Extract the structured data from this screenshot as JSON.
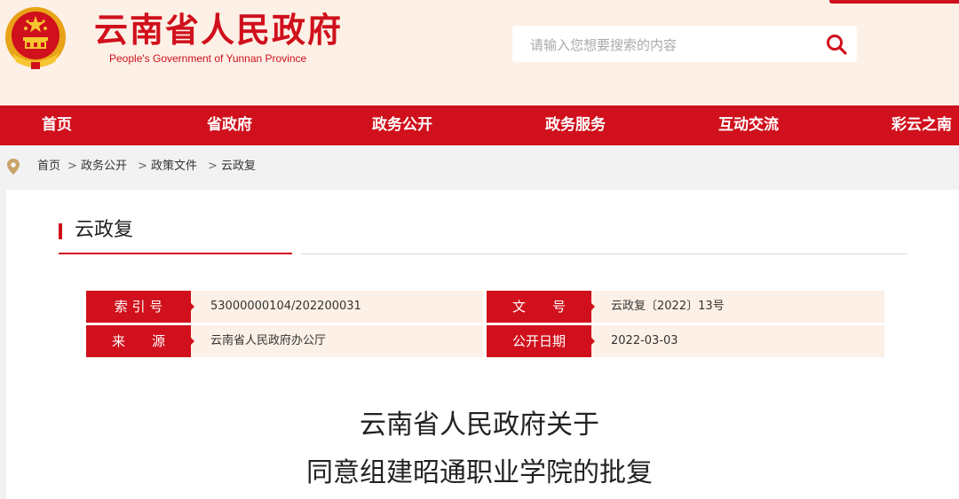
{
  "header": {
    "title": "云南省人民政府",
    "subtitle": "People's Government of Yunnan Province",
    "search_placeholder": "请输入您想要搜索的内容"
  },
  "nav": {
    "items": [
      "首页",
      "省政府",
      "政务公开",
      "政务服务",
      "互动交流",
      "彩云之南"
    ]
  },
  "breadcrumb": {
    "items": [
      "首页",
      "政务公开",
      "政策文件",
      "云政复"
    ],
    "separator": ">"
  },
  "section": {
    "title": "云政复"
  },
  "meta": {
    "index_label": "索 引 号",
    "index_value": "53000000104/202200031",
    "docno_label": "文　　号",
    "docno_value": "云政复〔2022〕13号",
    "source_label": "来　　源",
    "source_value": "云南省人民政府办公厅",
    "date_label": "公开日期",
    "date_value": "2022-03-03"
  },
  "document": {
    "title_line1": "云南省人民政府关于",
    "title_line2": "同意组建昭通职业学院的批复"
  },
  "colors": {
    "brand_red": "#d0101c",
    "header_bg": "#fdf0e6",
    "meta_bg": "#fdf0e6"
  }
}
